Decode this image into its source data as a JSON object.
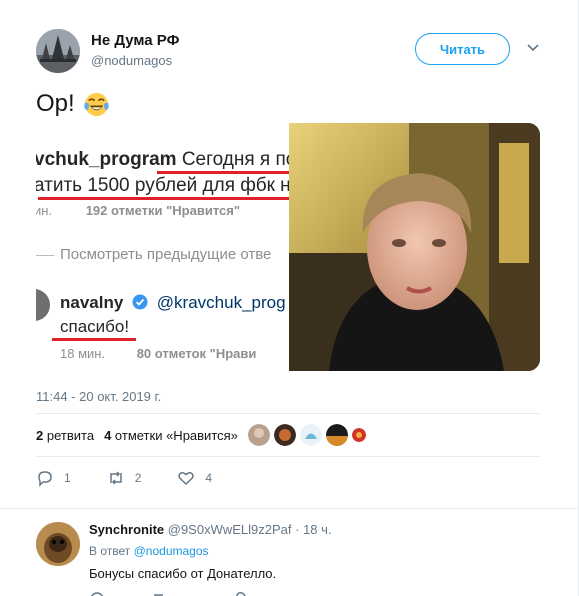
{
  "tweet": {
    "author": {
      "name": "Не Дума РФ",
      "handle": "@nodumagos"
    },
    "follow_label": "Читать",
    "text": "Ор!",
    "emoji": "face-with-tears-of-joy",
    "timestamp": "11:44 - 20 окт. 2019 г.",
    "retweets": {
      "count": "2",
      "label": "ретвита"
    },
    "likes": {
      "count": "4",
      "label": "отметки «Нравится»"
    },
    "actions": {
      "reply_count": "1",
      "retweet_count": "2",
      "like_count": "4"
    }
  },
  "media_screenshot": {
    "line1_user": "vchuk_program",
    "line1_text": "Сегодня я пойд",
    "line2_text": "атить 1500 рублей для фбк н",
    "line3_time": "ин.",
    "line3_likes": "192 отметки \"Нравится\"",
    "view_prev": "Посмотреть предыдущие отве",
    "reply_user": "navalny",
    "reply_mention": "@kravchuk_prog",
    "reply_text": "спасибо!",
    "reply_time": "18 мин.",
    "reply_likes": "80 отметок \"Нрави"
  },
  "reply": {
    "name": "Synchronite",
    "handle": "@9S0xWwELl9z2Paf",
    "time": "· 18 ч.",
    "in_reply_prefix": "В ответ",
    "in_reply_to": "@nodumagos",
    "text": "Бонусы спасибо от Донателло."
  },
  "colors": {
    "accent": "#1da1f2",
    "muted": "#657786",
    "underline_red": "#e0202a"
  }
}
